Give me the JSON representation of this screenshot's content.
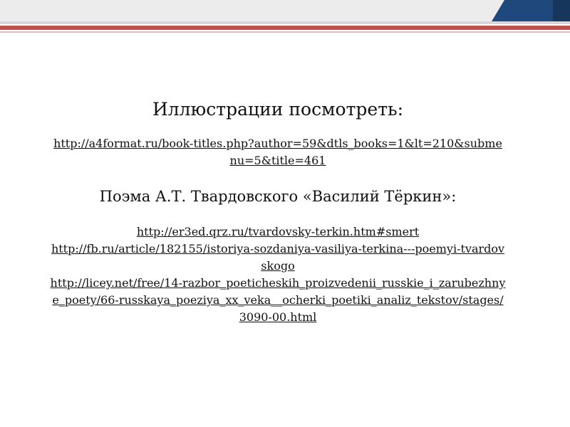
{
  "slide": {
    "heading": "Иллюстрации посмотреть:",
    "links_1": [
      "http://a4format.ru/book-titles.php?author=59&dtls_books=1&lt=210&submenu=5&title=461"
    ],
    "subheading": "Поэма А.Т. Твардовского «Василий Тёркин»:",
    "links_2": [
      "http://er3ed.qrz.ru/tvardovsky-terkin.htm#smert",
      "http://fb.ru/article/182155/istoriya-sozdaniya-vasiliya-terkina---poemyi-tvardovskogo",
      "http://licey.net/free/14-razbor_poeticheskih_proizvedenii_russkie_i_zarubezhnye_poety/66-russkaya_poeziya_xx_veka__ocherki_poetiki_analiz_tekstov/stages/3090-00.html"
    ]
  },
  "colors": {
    "accent_red": "#c0504d",
    "accent_navy": "#1f497d",
    "header_gray": "#ececec"
  }
}
